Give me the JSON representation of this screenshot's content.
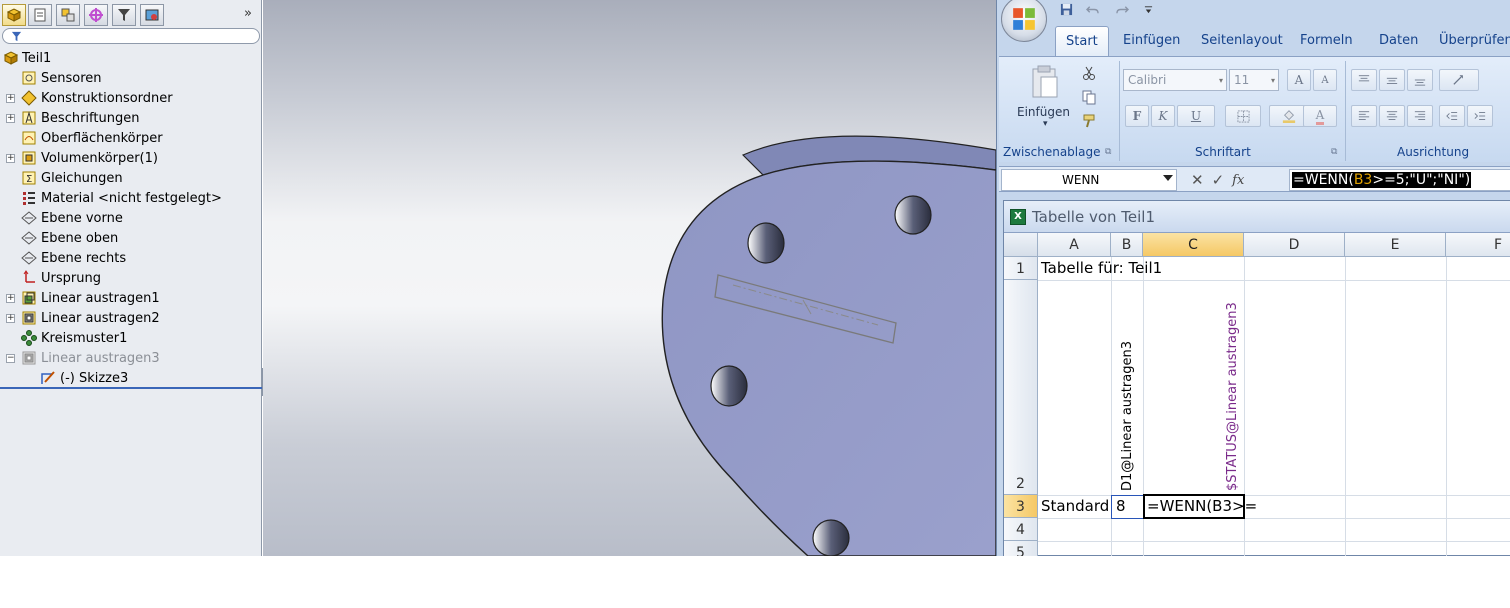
{
  "feature_tree": {
    "more_glyph": "»",
    "items": [
      {
        "label": "Teil1"
      },
      {
        "label": "Sensoren"
      },
      {
        "label": "Konstruktionsordner"
      },
      {
        "label": "Beschriftungen"
      },
      {
        "label": "Oberflächenkörper"
      },
      {
        "label": "Volumenkörper(1)"
      },
      {
        "label": "Gleichungen"
      },
      {
        "label": "Material <nicht festgelegt>"
      },
      {
        "label": "Ebene vorne"
      },
      {
        "label": "Ebene oben"
      },
      {
        "label": "Ebene rechts"
      },
      {
        "label": "Ursprung"
      },
      {
        "label": "Linear austragen1"
      },
      {
        "label": "Linear austragen2"
      },
      {
        "label": "Kreismuster1"
      },
      {
        "label": "Linear austragen3"
      },
      {
        "label": "(-) Skizze3"
      }
    ]
  },
  "excel": {
    "tabs": [
      "Start",
      "Einfügen",
      "Seitenlayout",
      "Formeln",
      "Daten",
      "Überprüfen"
    ],
    "clipboard": {
      "paste_label": "Einfügen",
      "group_label": "Zwischenablage"
    },
    "font": {
      "name": "Calibri",
      "size": "11",
      "group_label": "Schriftart",
      "bold": "F",
      "italic": "K",
      "underline": "U",
      "grow": "A",
      "shrink": "A",
      "color_a": "A"
    },
    "alignment": {
      "group_label": "Ausrichtung"
    },
    "formula_bar": {
      "name_box": "WENN",
      "fx": "fx",
      "formula_prefix": "=WENN(",
      "formula_ref": "B3",
      "formula_suffix": ">=5;\"U\";\"NI\")"
    },
    "sheet": {
      "title": "Tabelle von Teil1",
      "columns": [
        "A",
        "B",
        "C",
        "D",
        "E",
        "F"
      ],
      "rows": [
        "1",
        "2",
        "3",
        "4",
        "5"
      ],
      "a1": "Tabelle für: Teil1",
      "b2": "D1@Linear austragen3",
      "c2": "$STATUS@Linear austragen3",
      "a3": "Standard",
      "b3": "8",
      "c3": "=WENN(B3>="
    },
    "colors": {
      "header_selected": "#f5c865",
      "status_text": "#7a2a8a"
    }
  }
}
